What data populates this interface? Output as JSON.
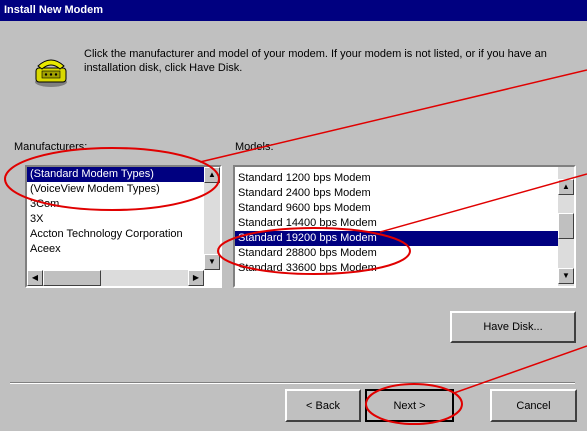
{
  "dialog": {
    "title": "Install New Modem",
    "instructions": "Click the manufacturer and model of your modem. If your modem is not listed, or if you have an installation disk, click Have Disk."
  },
  "manufacturers": {
    "label": "Manufacturers:",
    "items": [
      {
        "label": "(Standard Modem Types)",
        "selected": true
      },
      {
        "label": "(VoiceView Modem Types)",
        "selected": false
      },
      {
        "label": "3Com",
        "selected": false
      },
      {
        "label": "3X",
        "selected": false
      },
      {
        "label": "Accton Technology Corporation",
        "selected": false
      },
      {
        "label": "Aceex",
        "selected": false
      }
    ]
  },
  "models": {
    "label": "Models:",
    "items": [
      {
        "label": "Standard  1200 bps Modem",
        "selected": false
      },
      {
        "label": "Standard  2400 bps Modem",
        "selected": false
      },
      {
        "label": "Standard  9600 bps Modem",
        "selected": false
      },
      {
        "label": "Standard 14400 bps Modem",
        "selected": false
      },
      {
        "label": "Standard 19200 bps Modem",
        "selected": true
      },
      {
        "label": "Standard 28800 bps Modem",
        "selected": false
      },
      {
        "label": "Standard 33600 bps Modem",
        "selected": false
      }
    ]
  },
  "buttons": {
    "have_disk": "Have Disk...",
    "back": "< Back",
    "next": "Next >",
    "cancel": "Cancel"
  },
  "icons": {
    "modem": "modem-phone-icon",
    "scroll_up": "scroll-up-arrow-icon",
    "scroll_down": "scroll-down-arrow-icon",
    "scroll_left": "scroll-left-arrow-icon",
    "scroll_right": "scroll-right-arrow-icon"
  },
  "colors": {
    "title_bar": "#000080",
    "selection": "#000080",
    "annotation": "#ff0000",
    "dialog_face": "#c0c0c0"
  }
}
